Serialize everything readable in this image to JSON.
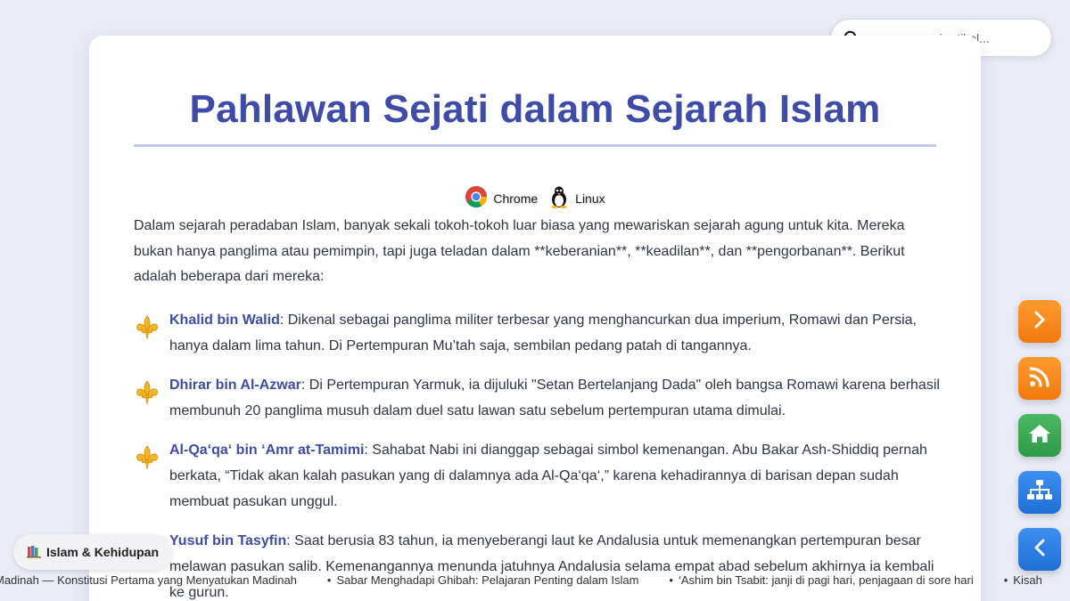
{
  "search": {
    "placeholder": "cari artikel..."
  },
  "article": {
    "title": "Pahlawan Sejati dalam Sejarah Islam",
    "browsers": [
      {
        "icon": "chrome-icon",
        "label": "Chrome"
      },
      {
        "icon": "linux-icon",
        "label": "Linux"
      }
    ],
    "intro": "Dalam sejarah peradaban Islam, banyak sekali tokoh-tokoh luar biasa yang mewariskan sejarah agung untuk kita. Mereka bukan hanya panglima atau pemimpin, tapi juga teladan dalam **keberanian**, **keadilan**, dan **pengorbanan**. Berikut adalah beberapa dari mereka:",
    "heroes": [
      {
        "name": "Khalid bin Walid",
        "text": ": Dikenal sebagai panglima militer terbesar yang menghancurkan dua imperium, Romawi dan Persia, hanya dalam lima tahun. Di Pertempuran Mu’tah saja, sembilan pedang patah di tangannya."
      },
      {
        "name": "Dhirar bin Al-Azwar",
        "text": ": Di Pertempuran Yarmuk, ia dijuluki \"Setan Bertelanjang Dada\" oleh bangsa Romawi karena berhasil membunuh 20 panglima musuh dalam duel satu lawan satu sebelum pertempuran utama dimulai."
      },
      {
        "name": "Al-Qa‘qa‘ bin ‘Amr at-Tamimi",
        "text": ": Sahabat Nabi ini dianggap sebagai simbol kemenangan. Abu Bakar Ash-Shiddiq pernah berkata, “Tidak akan kalah pasukan yang di dalamnya ada Al-Qa‘qa‘,” karena kehadirannya di barisan depan sudah membuat pasukan unggul."
      },
      {
        "name": "Yusuf bin Tasyfin",
        "text": ": Saat berusia 83 tahun, ia menyeberangi laut ke Andalusia untuk memenangkan pertempuran besar melawan pasukan salib. Kemenangannya menunda jatuhnya Andalusia selama empat abad sebelum akhirnya ia kembali ke gurun."
      }
    ]
  },
  "category": {
    "icon": "books-icon",
    "label": "Islam & Kehidupan"
  },
  "ticker": [
    "Madinah — Konstitusi Pertama yang Menyatukan Madinah",
    "Sabar Menghadapi Ghibah: Pelajaran Penting dalam Islam",
    "‘Ashim bin Tsabit: janji di pagi hari, penjagaan di sore hari",
    "Kisah"
  ],
  "colors": {
    "accent": "#3e4ba8",
    "background": "#e9ebf6",
    "fab_orange": "#f7871d",
    "fab_green": "#3aa853",
    "fab_blue": "#2d7fe5",
    "bullet_gold": "#f2b722"
  }
}
